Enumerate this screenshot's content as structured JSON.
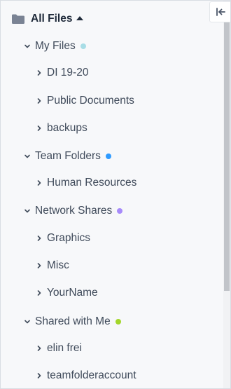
{
  "root": {
    "label": "All Files"
  },
  "groups": [
    {
      "label": "My Files",
      "dot_color": "#a8dde6",
      "children": [
        {
          "label": "DI 19-20"
        },
        {
          "label": "Public Documents"
        },
        {
          "label": "backups"
        }
      ]
    },
    {
      "label": "Team Folders",
      "dot_color": "#2f9bff",
      "children": [
        {
          "label": "Human Resources"
        }
      ]
    },
    {
      "label": "Network Shares",
      "dot_color": "#a78bfa",
      "children": [
        {
          "label": "Graphics"
        },
        {
          "label": "Misc"
        },
        {
          "label": "YourName"
        }
      ]
    },
    {
      "label": "Shared with Me",
      "dot_color": "#a3d62a",
      "children": [
        {
          "label": "elin frei"
        },
        {
          "label": "teamfolderaccount"
        }
      ]
    }
  ],
  "icons": {
    "root": "folder-icon",
    "collapse": "collapse-panel-icon",
    "expanded": "chevron-down-icon",
    "collapsed": "chevron-right-icon"
  }
}
